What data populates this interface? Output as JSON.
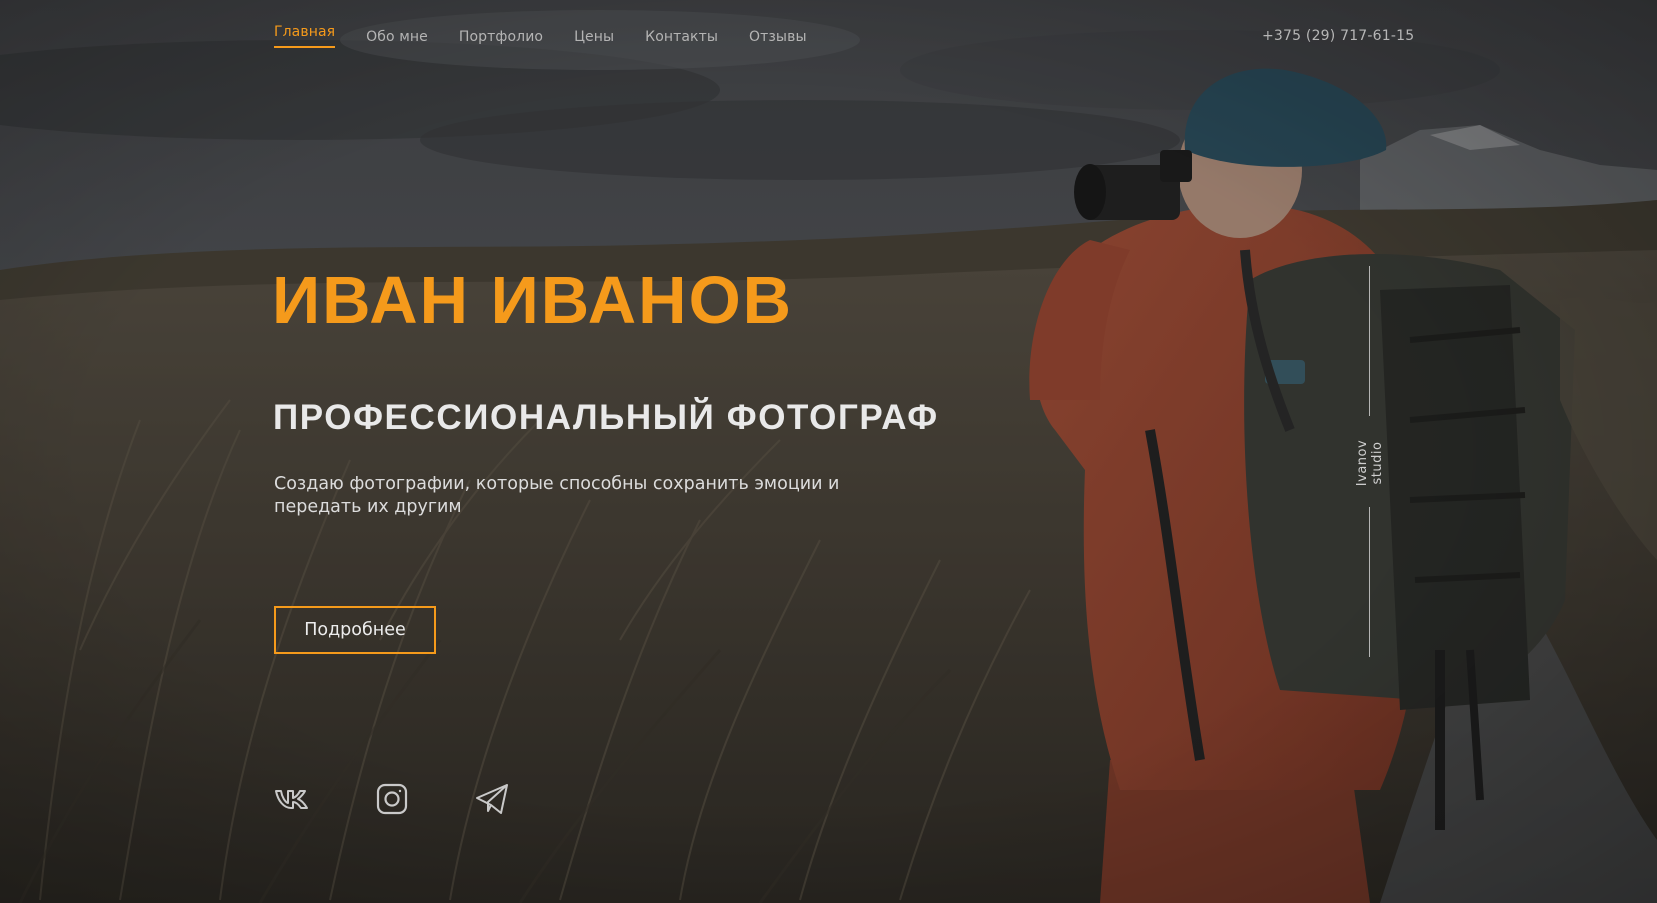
{
  "nav": {
    "items": [
      {
        "label": "Главная",
        "active": true
      },
      {
        "label": "Обо мне",
        "active": false
      },
      {
        "label": "Портфолио",
        "active": false
      },
      {
        "label": "Цены",
        "active": false
      },
      {
        "label": "Контакты",
        "active": false
      },
      {
        "label": "Отзывы",
        "active": false
      }
    ],
    "phone": "+375 (29) 717-61-15"
  },
  "hero": {
    "title": "ИВАН ИВАНОВ",
    "subtitle": "ПРОФЕССИОНАЛЬНЫЙ ФОТОГРАФ",
    "description": "Создаю фотографии, которые способны сохранить эмоции и передать их другим",
    "cta_label": "Подробнее"
  },
  "socials": [
    {
      "icon": "vk-icon"
    },
    {
      "icon": "instagram-icon"
    },
    {
      "icon": "telegram-icon"
    }
  ],
  "studio_mark": {
    "line1": "Ivanov",
    "line2": "studio"
  },
  "colors": {
    "accent": "#f59a1b",
    "text": "#e6e6e6",
    "muted": "#b4b4b4"
  }
}
